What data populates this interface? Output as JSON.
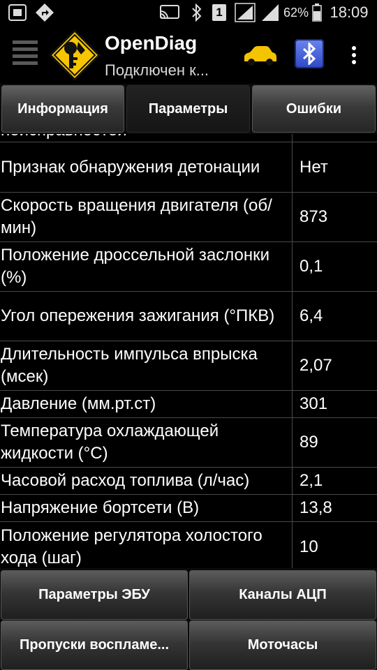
{
  "status_bar": {
    "battery": "62%",
    "time": "18:09",
    "sim": "1"
  },
  "app_bar": {
    "title": "OpenDiag",
    "subtitle": "Подключен к..."
  },
  "tabs": [
    {
      "label": "Информация",
      "active": false
    },
    {
      "label": "Параметры",
      "active": true
    },
    {
      "label": "Ошибки",
      "active": false
    }
  ],
  "partial_row_label": "неисправностей",
  "params": [
    {
      "label": "Признак обнаружения детонации",
      "value": "Нет"
    },
    {
      "label": "Скорость вращения двигателя (об/мин)",
      "value": "873"
    },
    {
      "label": "Положение дроссельной заслонки (%)",
      "value": "0,1"
    },
    {
      "label": "Угол опережения зажигания (°ПКВ)",
      "value": "6,4"
    },
    {
      "label": "Длительность импульса впрыска (мсек)",
      "value": "2,07"
    },
    {
      "label": "Давление (мм.рт.ст)",
      "value": "301"
    },
    {
      "label": "Температура охлаждающей жидкости (°С)",
      "value": "89"
    },
    {
      "label": "Часовой расход топлива (л/час)",
      "value": "2,1"
    },
    {
      "label": "Напряжение бортсети (В)",
      "value": "13,8"
    },
    {
      "label": "Положение регулятора холостого хода (шаг)",
      "value": "10"
    }
  ],
  "bottom_buttons": [
    {
      "label": "Параметры ЭБУ"
    },
    {
      "label": "Каналы АЦП"
    },
    {
      "label": "Пропуски воспламе..."
    },
    {
      "label": "Моточасы"
    }
  ],
  "colors": {
    "car_icon": "#f5c400",
    "bluetooth_bg": "#3b5bd6",
    "logo_yellow": "#f7c600"
  }
}
